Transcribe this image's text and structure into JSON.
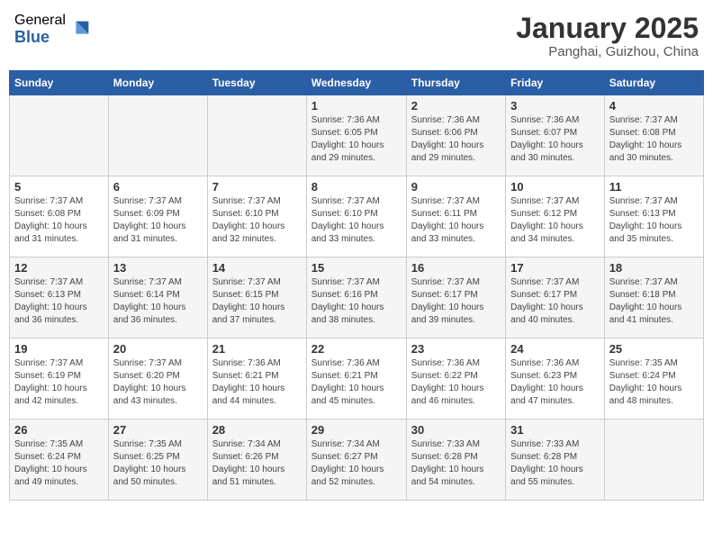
{
  "header": {
    "logo_general": "General",
    "logo_blue": "Blue",
    "month_title": "January 2025",
    "location": "Panghai, Guizhou, China"
  },
  "weekdays": [
    "Sunday",
    "Monday",
    "Tuesday",
    "Wednesday",
    "Thursday",
    "Friday",
    "Saturday"
  ],
  "weeks": [
    [
      {
        "day": "",
        "info": ""
      },
      {
        "day": "",
        "info": ""
      },
      {
        "day": "",
        "info": ""
      },
      {
        "day": "1",
        "info": "Sunrise: 7:36 AM\nSunset: 6:05 PM\nDaylight: 10 hours and 29 minutes."
      },
      {
        "day": "2",
        "info": "Sunrise: 7:36 AM\nSunset: 6:06 PM\nDaylight: 10 hours and 29 minutes."
      },
      {
        "day": "3",
        "info": "Sunrise: 7:36 AM\nSunset: 6:07 PM\nDaylight: 10 hours and 30 minutes."
      },
      {
        "day": "4",
        "info": "Sunrise: 7:37 AM\nSunset: 6:08 PM\nDaylight: 10 hours and 30 minutes."
      }
    ],
    [
      {
        "day": "5",
        "info": "Sunrise: 7:37 AM\nSunset: 6:08 PM\nDaylight: 10 hours and 31 minutes."
      },
      {
        "day": "6",
        "info": "Sunrise: 7:37 AM\nSunset: 6:09 PM\nDaylight: 10 hours and 31 minutes."
      },
      {
        "day": "7",
        "info": "Sunrise: 7:37 AM\nSunset: 6:10 PM\nDaylight: 10 hours and 32 minutes."
      },
      {
        "day": "8",
        "info": "Sunrise: 7:37 AM\nSunset: 6:10 PM\nDaylight: 10 hours and 33 minutes."
      },
      {
        "day": "9",
        "info": "Sunrise: 7:37 AM\nSunset: 6:11 PM\nDaylight: 10 hours and 33 minutes."
      },
      {
        "day": "10",
        "info": "Sunrise: 7:37 AM\nSunset: 6:12 PM\nDaylight: 10 hours and 34 minutes."
      },
      {
        "day": "11",
        "info": "Sunrise: 7:37 AM\nSunset: 6:13 PM\nDaylight: 10 hours and 35 minutes."
      }
    ],
    [
      {
        "day": "12",
        "info": "Sunrise: 7:37 AM\nSunset: 6:13 PM\nDaylight: 10 hours and 36 minutes."
      },
      {
        "day": "13",
        "info": "Sunrise: 7:37 AM\nSunset: 6:14 PM\nDaylight: 10 hours and 36 minutes."
      },
      {
        "day": "14",
        "info": "Sunrise: 7:37 AM\nSunset: 6:15 PM\nDaylight: 10 hours and 37 minutes."
      },
      {
        "day": "15",
        "info": "Sunrise: 7:37 AM\nSunset: 6:16 PM\nDaylight: 10 hours and 38 minutes."
      },
      {
        "day": "16",
        "info": "Sunrise: 7:37 AM\nSunset: 6:17 PM\nDaylight: 10 hours and 39 minutes."
      },
      {
        "day": "17",
        "info": "Sunrise: 7:37 AM\nSunset: 6:17 PM\nDaylight: 10 hours and 40 minutes."
      },
      {
        "day": "18",
        "info": "Sunrise: 7:37 AM\nSunset: 6:18 PM\nDaylight: 10 hours and 41 minutes."
      }
    ],
    [
      {
        "day": "19",
        "info": "Sunrise: 7:37 AM\nSunset: 6:19 PM\nDaylight: 10 hours and 42 minutes."
      },
      {
        "day": "20",
        "info": "Sunrise: 7:37 AM\nSunset: 6:20 PM\nDaylight: 10 hours and 43 minutes."
      },
      {
        "day": "21",
        "info": "Sunrise: 7:36 AM\nSunset: 6:21 PM\nDaylight: 10 hours and 44 minutes."
      },
      {
        "day": "22",
        "info": "Sunrise: 7:36 AM\nSunset: 6:21 PM\nDaylight: 10 hours and 45 minutes."
      },
      {
        "day": "23",
        "info": "Sunrise: 7:36 AM\nSunset: 6:22 PM\nDaylight: 10 hours and 46 minutes."
      },
      {
        "day": "24",
        "info": "Sunrise: 7:36 AM\nSunset: 6:23 PM\nDaylight: 10 hours and 47 minutes."
      },
      {
        "day": "25",
        "info": "Sunrise: 7:35 AM\nSunset: 6:24 PM\nDaylight: 10 hours and 48 minutes."
      }
    ],
    [
      {
        "day": "26",
        "info": "Sunrise: 7:35 AM\nSunset: 6:24 PM\nDaylight: 10 hours and 49 minutes."
      },
      {
        "day": "27",
        "info": "Sunrise: 7:35 AM\nSunset: 6:25 PM\nDaylight: 10 hours and 50 minutes."
      },
      {
        "day": "28",
        "info": "Sunrise: 7:34 AM\nSunset: 6:26 PM\nDaylight: 10 hours and 51 minutes."
      },
      {
        "day": "29",
        "info": "Sunrise: 7:34 AM\nSunset: 6:27 PM\nDaylight: 10 hours and 52 minutes."
      },
      {
        "day": "30",
        "info": "Sunrise: 7:33 AM\nSunset: 6:28 PM\nDaylight: 10 hours and 54 minutes."
      },
      {
        "day": "31",
        "info": "Sunrise: 7:33 AM\nSunset: 6:28 PM\nDaylight: 10 hours and 55 minutes."
      },
      {
        "day": "",
        "info": ""
      }
    ]
  ]
}
